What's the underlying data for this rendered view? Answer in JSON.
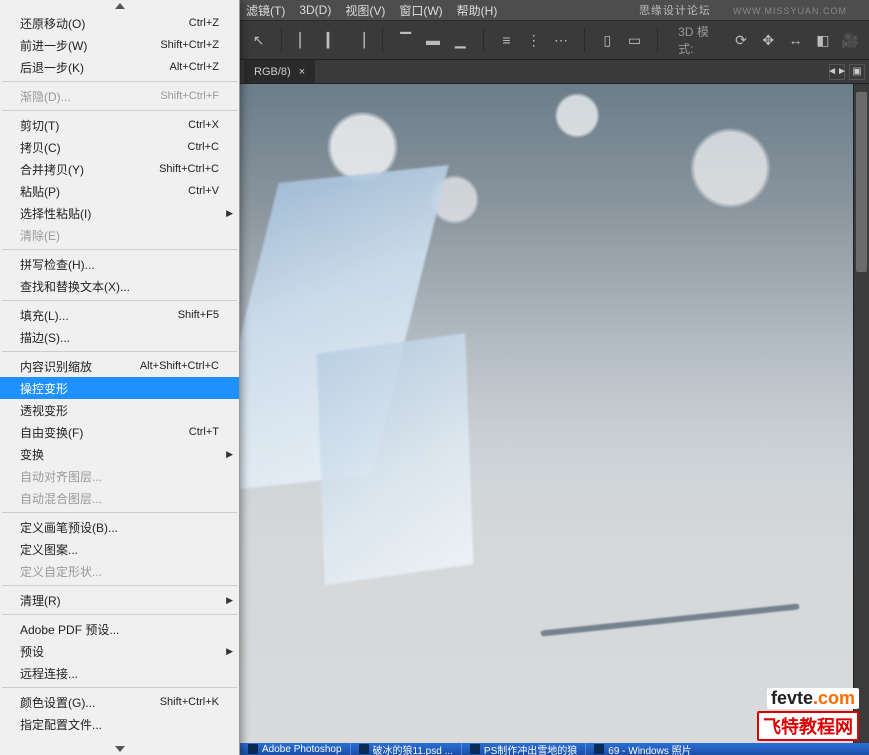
{
  "menubar": {
    "items": [
      "滤镜(T)",
      "3D(D)",
      "视图(V)",
      "窗口(W)",
      "帮助(H)"
    ],
    "brand": "思缘设计论坛",
    "brand_url": "WWW.MISSYUAN.COM"
  },
  "toolbar": {
    "mode_label": "3D 模式:"
  },
  "document": {
    "tab_label": "RGB/8)",
    "tab_close": "×"
  },
  "edit_menu": [
    {
      "type": "item",
      "label": "还原移动(O)",
      "shortcut": "Ctrl+Z"
    },
    {
      "type": "item",
      "label": "前进一步(W)",
      "shortcut": "Shift+Ctrl+Z"
    },
    {
      "type": "item",
      "label": "后退一步(K)",
      "shortcut": "Alt+Ctrl+Z"
    },
    {
      "type": "sep"
    },
    {
      "type": "item",
      "label": "渐隐(D)...",
      "shortcut": "Shift+Ctrl+F",
      "disabled": true
    },
    {
      "type": "sep"
    },
    {
      "type": "item",
      "label": "剪切(T)",
      "shortcut": "Ctrl+X"
    },
    {
      "type": "item",
      "label": "拷贝(C)",
      "shortcut": "Ctrl+C"
    },
    {
      "type": "item",
      "label": "合并拷贝(Y)",
      "shortcut": "Shift+Ctrl+C"
    },
    {
      "type": "item",
      "label": "粘贴(P)",
      "shortcut": "Ctrl+V"
    },
    {
      "type": "item",
      "label": "选择性粘贴(I)",
      "shortcut": "",
      "submenu": true
    },
    {
      "type": "item",
      "label": "清除(E)",
      "disabled": true
    },
    {
      "type": "sep"
    },
    {
      "type": "item",
      "label": "拼写检查(H)..."
    },
    {
      "type": "item",
      "label": "查找和替换文本(X)..."
    },
    {
      "type": "sep"
    },
    {
      "type": "item",
      "label": "填充(L)...",
      "shortcut": "Shift+F5"
    },
    {
      "type": "item",
      "label": "描边(S)..."
    },
    {
      "type": "sep"
    },
    {
      "type": "item",
      "label": "内容识别缩放",
      "shortcut": "Alt+Shift+Ctrl+C"
    },
    {
      "type": "item",
      "label": "操控变形",
      "selected": true
    },
    {
      "type": "item",
      "label": "透视变形"
    },
    {
      "type": "item",
      "label": "自由变换(F)",
      "shortcut": "Ctrl+T"
    },
    {
      "type": "item",
      "label": "变换",
      "submenu": true
    },
    {
      "type": "item",
      "label": "自动对齐图层...",
      "disabled": true
    },
    {
      "type": "item",
      "label": "自动混合图层...",
      "disabled": true
    },
    {
      "type": "sep"
    },
    {
      "type": "item",
      "label": "定义画笔预设(B)..."
    },
    {
      "type": "item",
      "label": "定义图案..."
    },
    {
      "type": "item",
      "label": "定义自定形状...",
      "disabled": true
    },
    {
      "type": "sep"
    },
    {
      "type": "item",
      "label": "清理(R)",
      "submenu": true
    },
    {
      "type": "sep"
    },
    {
      "type": "item",
      "label": "Adobe PDF 预设..."
    },
    {
      "type": "item",
      "label": "预设",
      "submenu": true
    },
    {
      "type": "item",
      "label": "远程连接..."
    },
    {
      "type": "sep"
    },
    {
      "type": "item",
      "label": "颜色设置(G)...",
      "shortcut": "Shift+Ctrl+K"
    },
    {
      "type": "item",
      "label": "指定配置文件..."
    }
  ],
  "taskbar": {
    "items": [
      "Adobe Photoshop",
      "破冰的狼11.psd ...",
      "PS制作冲出雪地的狼",
      "69 - Windows 照片"
    ]
  },
  "watermark": {
    "line1a": "fevte",
    "line1b": ".com",
    "line2": "飞特教程网"
  }
}
